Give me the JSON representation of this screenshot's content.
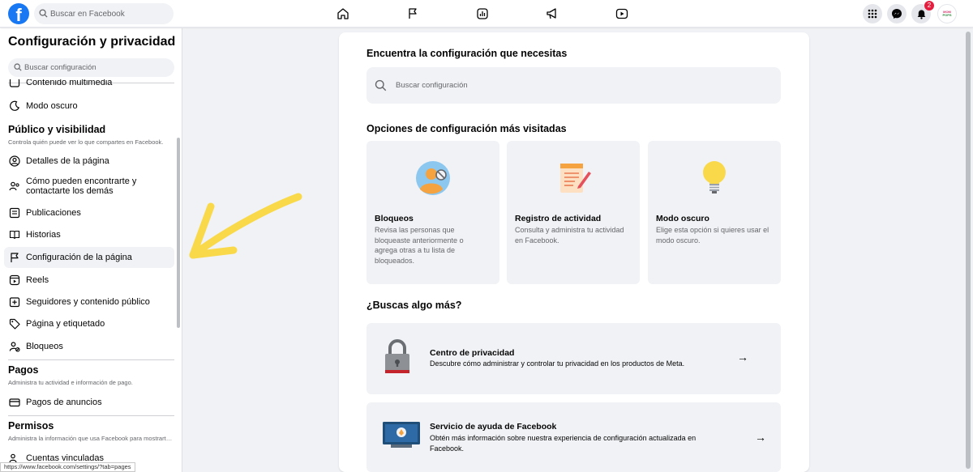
{
  "topbar": {
    "logo": "facebook-logo",
    "search_placeholder": "Buscar en Facebook",
    "nav_icons": [
      "home-icon",
      "flag-icon",
      "insights-icon",
      "megaphone-icon",
      "video-icon"
    ],
    "notification_count": "2",
    "avatar_text_line1": "MOM",
    "avatar_text_line2": "POPS"
  },
  "sidebar": {
    "title": "Configuración y privacidad",
    "search_placeholder": "Buscar configuración",
    "top_items": [
      {
        "label": "Contenido multimedia",
        "icon": "media-icon"
      },
      {
        "label": "Modo oscuro",
        "icon": "moon-icon"
      }
    ],
    "section_public": {
      "heading": "Público y visibilidad",
      "subtitle": "Controla quién puede ver lo que compartes en Facebook.",
      "items": [
        {
          "label": "Detalles de la página",
          "icon": "person-circle-icon"
        },
        {
          "label": "Cómo pueden encontrarte y contactarte los demás",
          "icon": "people-icon"
        },
        {
          "label": "Publicaciones",
          "icon": "posts-icon"
        },
        {
          "label": "Historias",
          "icon": "book-icon"
        },
        {
          "label": "Configuración de la página",
          "icon": "flag-settings-icon"
        },
        {
          "label": "Reels",
          "icon": "reels-icon"
        },
        {
          "label": "Seguidores y contenido público",
          "icon": "followers-icon"
        },
        {
          "label": "Página y etiquetado",
          "icon": "tag-icon"
        },
        {
          "label": "Bloqueos",
          "icon": "block-user-icon"
        }
      ]
    },
    "section_payments": {
      "heading": "Pagos",
      "subtitle": "Administra tu actividad e información de pago.",
      "items": [
        {
          "label": "Pagos de anuncios",
          "icon": "credit-card-icon"
        }
      ]
    },
    "section_permissions": {
      "heading": "Permisos",
      "subtitle": "Administra la información que usa Facebook para mostrarte contenido.",
      "items": [
        {
          "label": "Cuentas vinculadas",
          "icon": "linked-accounts-icon"
        }
      ]
    }
  },
  "status_url": "https://www.facebook.com/settings/?tab=pages",
  "main": {
    "find_heading": "Encuentra la configuración que necesitas",
    "search_placeholder": "Buscar configuración",
    "visited_heading": "Opciones de configuración más visitadas",
    "cards": [
      {
        "title": "Bloqueos",
        "desc": "Revisa las personas que bloqueaste anteriormente o agrega otras a tu lista de bloqueados.",
        "icon": "blocked-person-illustration"
      },
      {
        "title": "Registro de actividad",
        "desc": "Consulta y administra tu actividad en Facebook.",
        "icon": "activity-log-illustration"
      },
      {
        "title": "Modo oscuro",
        "desc": "Elige esta opción si quieres usar el modo oscuro.",
        "icon": "lightbulb-illustration"
      }
    ],
    "more_heading": "¿Buscas algo más?",
    "rows": [
      {
        "title": "Centro de privacidad",
        "desc": "Descubre cómo administrar y controlar tu privacidad en los productos de Meta.",
        "icon": "padlock-illustration",
        "arrow": "→"
      },
      {
        "title": "Servicio de ayuda de Facebook",
        "desc": "Obtén más información sobre nuestra experiencia de configuración actualizada en Facebook.",
        "icon": "help-monitor-illustration",
        "arrow": "→"
      }
    ]
  },
  "colors": {
    "brand": "#1877f2",
    "annotation_arrow": "#f9d94a",
    "badge": "#e41e3f"
  }
}
